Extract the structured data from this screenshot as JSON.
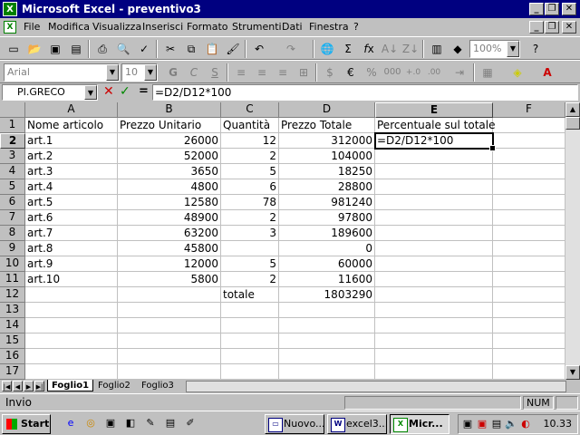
{
  "window": {
    "title": "Microsoft Excel - preventivo3",
    "app_icon": "X",
    "minimize": "_",
    "restore": "❐",
    "close": "✕"
  },
  "menu": {
    "items": [
      "File",
      "Modifica",
      "Visualizza",
      "Inserisci",
      "Formato",
      "Strumenti",
      "Dati",
      "Finestra",
      "?"
    ]
  },
  "toolbar": {
    "zoom": "100%",
    "font": "Arial",
    "font_size": "10",
    "bold": "G",
    "italic": "C",
    "underline": "S"
  },
  "formula_bar": {
    "name_box": "PI.GRECO",
    "cancel": "✕",
    "enter": "✓",
    "equals": "=",
    "formula": "=D2/D12*100"
  },
  "sheet": {
    "columns": [
      "A",
      "B",
      "C",
      "D",
      "E",
      "F"
    ],
    "active_column": "E",
    "active_row": "2",
    "rows": [
      {
        "n": "1",
        "cells": [
          "Nome articolo",
          "Prezzo Unitario",
          "Quantità",
          "Prezzo Totale",
          "Percentuale sul totale",
          ""
        ]
      },
      {
        "n": "2",
        "cells": [
          "art.1",
          "26000",
          "12",
          "312000",
          "=D2/D12*100",
          ""
        ]
      },
      {
        "n": "3",
        "cells": [
          "art.2",
          "52000",
          "2",
          "104000",
          "",
          ""
        ]
      },
      {
        "n": "4",
        "cells": [
          "art.3",
          "3650",
          "5",
          "18250",
          "",
          ""
        ]
      },
      {
        "n": "5",
        "cells": [
          "art.4",
          "4800",
          "6",
          "28800",
          "",
          ""
        ]
      },
      {
        "n": "6",
        "cells": [
          "art.5",
          "12580",
          "78",
          "981240",
          "",
          ""
        ]
      },
      {
        "n": "7",
        "cells": [
          "art.6",
          "48900",
          "2",
          "97800",
          "",
          ""
        ]
      },
      {
        "n": "8",
        "cells": [
          "art.7",
          "63200",
          "3",
          "189600",
          "",
          ""
        ]
      },
      {
        "n": "9",
        "cells": [
          "art.8",
          "45800",
          "",
          "0",
          "",
          ""
        ]
      },
      {
        "n": "10",
        "cells": [
          "art.9",
          "12000",
          "5",
          "60000",
          "",
          ""
        ]
      },
      {
        "n": "11",
        "cells": [
          "art.10",
          "5800",
          "2",
          "11600",
          "",
          ""
        ]
      },
      {
        "n": "12",
        "cells": [
          "",
          "",
          "totale",
          "1803290",
          "",
          ""
        ]
      },
      {
        "n": "13",
        "cells": [
          "",
          "",
          "",
          "",
          "",
          ""
        ]
      },
      {
        "n": "14",
        "cells": [
          "",
          "",
          "",
          "",
          "",
          ""
        ]
      },
      {
        "n": "15",
        "cells": [
          "",
          "",
          "",
          "",
          "",
          ""
        ]
      },
      {
        "n": "16",
        "cells": [
          "",
          "",
          "",
          "",
          "",
          ""
        ]
      },
      {
        "n": "17",
        "cells": [
          "",
          "",
          "",
          "",
          "",
          ""
        ]
      }
    ],
    "numeric_columns": [
      false,
      true,
      true,
      true,
      false,
      false
    ]
  },
  "tabs": {
    "sheets": [
      "Foglio1",
      "Foglio2",
      "Foglio3"
    ],
    "active": "Foglio1"
  },
  "status": {
    "mode": "Invio",
    "num": "NUM"
  },
  "taskbar": {
    "start": "Start",
    "tasks": [
      {
        "label": "Nuovo...",
        "active": false
      },
      {
        "label": "excel3...",
        "active": false
      },
      {
        "label": "Micr...",
        "active": true
      }
    ],
    "clock": "10.33"
  },
  "colors": {
    "titlebar": "#000080",
    "face": "#c0c0c0"
  }
}
